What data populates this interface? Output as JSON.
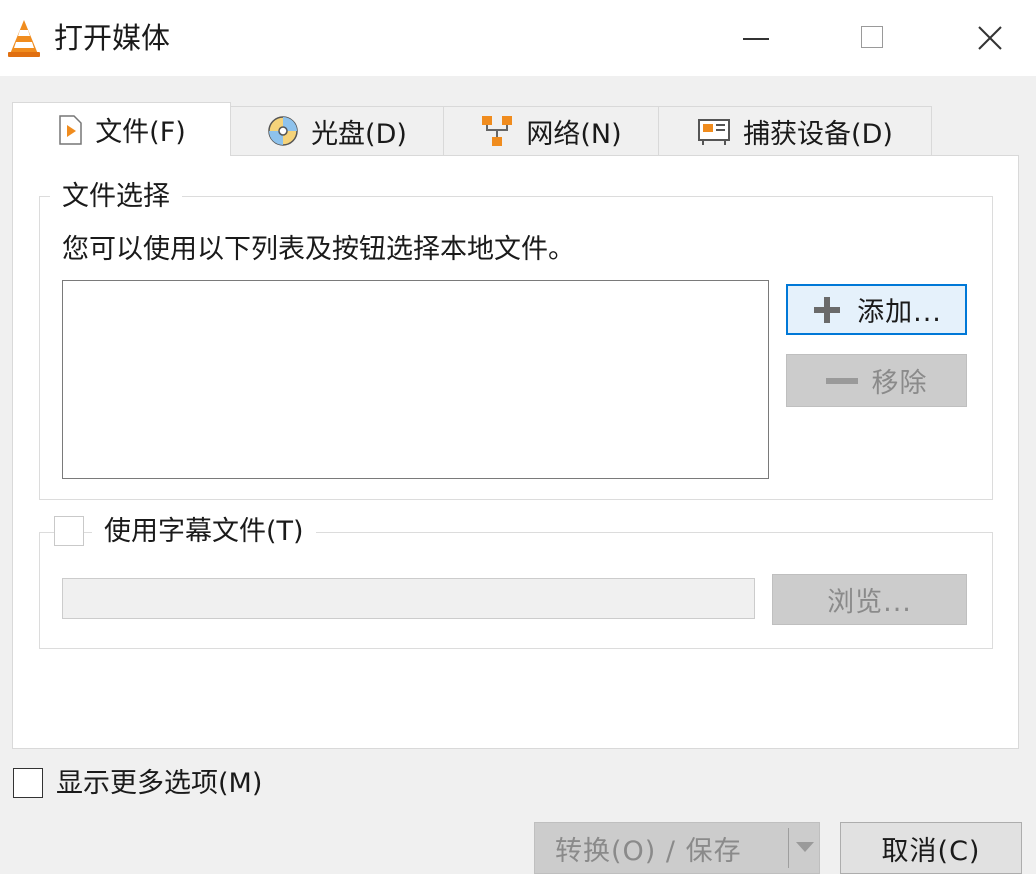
{
  "window": {
    "title": "打开媒体",
    "app_icon": "vlc-cone-icon",
    "controls": [
      "minimize-icon",
      "maximize-icon",
      "close-icon"
    ]
  },
  "tabs": [
    {
      "label": "文件(F)",
      "icon": "file-play-icon",
      "active": true
    },
    {
      "label": "光盘(D)",
      "icon": "disc-icon",
      "active": false
    },
    {
      "label": "网络(N)",
      "icon": "network-icon",
      "active": false
    },
    {
      "label": "捕获设备(D)",
      "icon": "capture-card-icon",
      "active": false
    }
  ],
  "file_selection": {
    "group_title": "文件选择",
    "description": "您可以使用以下列表及按钮选择本地文件。",
    "files": [],
    "add_button": "添加...",
    "remove_button": "移除"
  },
  "subtitle": {
    "checkbox_label": "使用字幕文件(T)",
    "checked": false,
    "path_value": "",
    "browse_button": "浏览..."
  },
  "footer": {
    "more_options_label": "显示更多选项(M)",
    "more_options_checked": false,
    "convert_save_button": "转换(O) / 保存",
    "cancel_button": "取消(C)"
  },
  "colors": {
    "accent": "#0078d7",
    "vlc_orange": "#f08c1e",
    "disabled_bg": "#cccccc"
  }
}
